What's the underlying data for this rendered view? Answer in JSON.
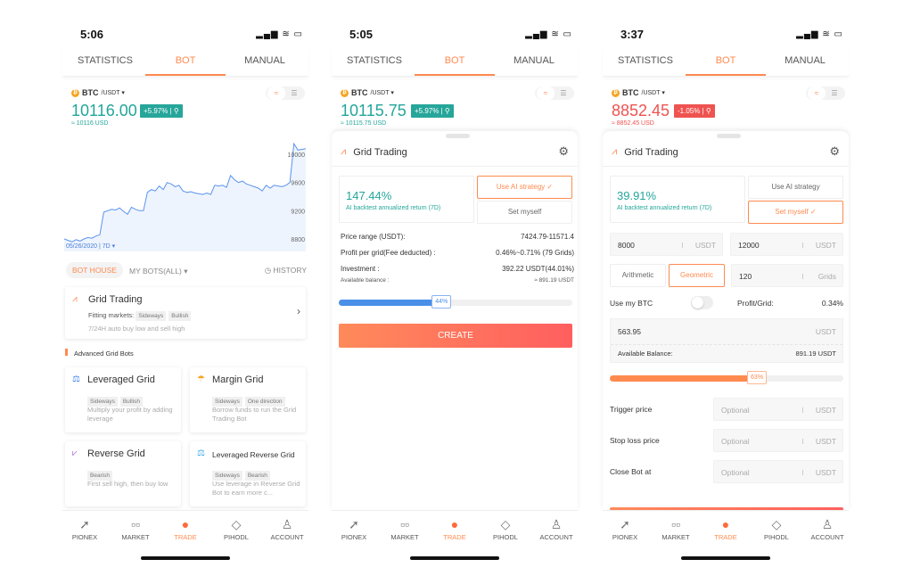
{
  "colors": {
    "accent": "#ff8a50",
    "up": "#23a69a",
    "down": "#ef5350"
  },
  "tabs": [
    "STATISTICS",
    "BOT",
    "MANUAL"
  ],
  "nav": [
    {
      "label": "PIONEX",
      "icon": "pionex-logo-icon"
    },
    {
      "label": "MARKET",
      "icon": "market-icon"
    },
    {
      "label": "TRADE",
      "icon": "trade-icon"
    },
    {
      "label": "PIHODL",
      "icon": "diamond-icon"
    },
    {
      "label": "ACCOUNT",
      "icon": "user-icon"
    }
  ],
  "screen1": {
    "time": "5:06",
    "pair": "BTC",
    "quote": "/USDT ▾",
    "price": "10116.00",
    "change": "+5.97%",
    "usd": "≈ 10116 USD",
    "chart": {
      "y_ticks": [
        "10000",
        "9600",
        "9200",
        "8800"
      ],
      "date_label": "05/26/2020 | 7D ▾",
      "values": [
        8800,
        8780,
        8760,
        8790,
        8770,
        8800,
        8820,
        8810,
        8840,
        8860,
        9180,
        9200,
        9220,
        9210,
        9240,
        9190,
        9150,
        9250,
        9220,
        9200,
        9200,
        9460,
        9500,
        9480,
        9550,
        9500,
        9600,
        9580,
        9540,
        9560,
        9480,
        9460,
        9470,
        9450,
        9440,
        9430,
        9450,
        9430,
        9560,
        9550,
        9560,
        9530,
        9700,
        9640,
        9600,
        9620,
        9580,
        9560,
        9540,
        9520,
        9480,
        9560,
        9520,
        9560,
        9550,
        9540,
        9560,
        9600,
        10150,
        10060,
        10070,
        10080
      ]
    },
    "bot_house": "BOT HOUSE",
    "my_bots": "MY BOTS(ALL) ▾",
    "history": "HISTORY",
    "grid": {
      "title": "Grid Trading",
      "fitting": "Fitting markets:",
      "tags": [
        "Sideways",
        "Bullish"
      ],
      "desc": "7/24H auto buy low and sell high"
    },
    "advanced_title": "Advanced Grid Bots",
    "bots": [
      {
        "title": "Leveraged Grid",
        "tags": [
          "Sideways",
          "Bullish"
        ],
        "desc": "Multiply your profit by adding leverage"
      },
      {
        "title": "Margin Grid",
        "tags": [
          "Sideways",
          "One direction"
        ],
        "desc": "Borrow funds to run the Grid Trading Bot"
      },
      {
        "title": "Reverse Grid",
        "tags": [
          "Bearish"
        ],
        "desc": "First sell high, then buy low"
      },
      {
        "title": "Leveraged Reverse Grid",
        "tags": [
          "Sideways",
          "Bearish"
        ],
        "desc": "Use leverage in Reverse Grid Bot to earn more c..."
      }
    ]
  },
  "screen2": {
    "time": "5:05",
    "pair": "BTC",
    "quote": "/USDT ▾",
    "price": "10115.75",
    "change": "+5.97%",
    "usd": "≈ 10115.75 USD",
    "title": "Grid Trading",
    "return": "147.44%",
    "return_label": "AI backtest annualized return (7D)",
    "use_ai": "Use AI strategy ✓",
    "set_myself": "Set myself",
    "rows": [
      {
        "label": "Price range (USDT):",
        "value": "7424.79-11571.4"
      },
      {
        "label": "Profit per grid(Fee deducted) :",
        "value": "0.46%~0.71% (79 Grids)"
      },
      {
        "label": "Investment :",
        "value": "392.22 USDT(44.01%)"
      }
    ],
    "balance_label": "Available balance :",
    "balance": "≈ 891.19 USDT",
    "slider_pct": 44,
    "slider_label": "44%",
    "create": "CREATE"
  },
  "screen3": {
    "time": "3:37",
    "pair": "BTC",
    "quote": "/USDT ▾",
    "price": "8852.45",
    "change": "-1.05%",
    "usd": "≈ 8852.45 USD",
    "title": "Grid Trading",
    "return": "39.91%",
    "return_label": "AI backtest annualized return (7D)",
    "use_ai": "Use AI strategy",
    "set_myself": "Set myself ✓",
    "lower": "8000",
    "upper": "12000",
    "unit": "USDT",
    "arithmetic": "Arithmetic",
    "geometric": "Geometric",
    "grids": "120",
    "grids_unit": "Grids",
    "use_btc": "Use my BTC",
    "use_btc_on": false,
    "profit_label": "Profit/Grid:",
    "profit": "0.34%",
    "amount": "563.95",
    "avail_label": "Available Balance:",
    "avail": "891.19 USDT",
    "slider_pct": 63,
    "slider_label": "63%",
    "optional_rows": [
      {
        "label": "Trigger price",
        "placeholder": "Optional"
      },
      {
        "label": "Stop loss price",
        "placeholder": "Optional"
      },
      {
        "label": "Close Bot at",
        "placeholder": "Optional"
      }
    ]
  }
}
